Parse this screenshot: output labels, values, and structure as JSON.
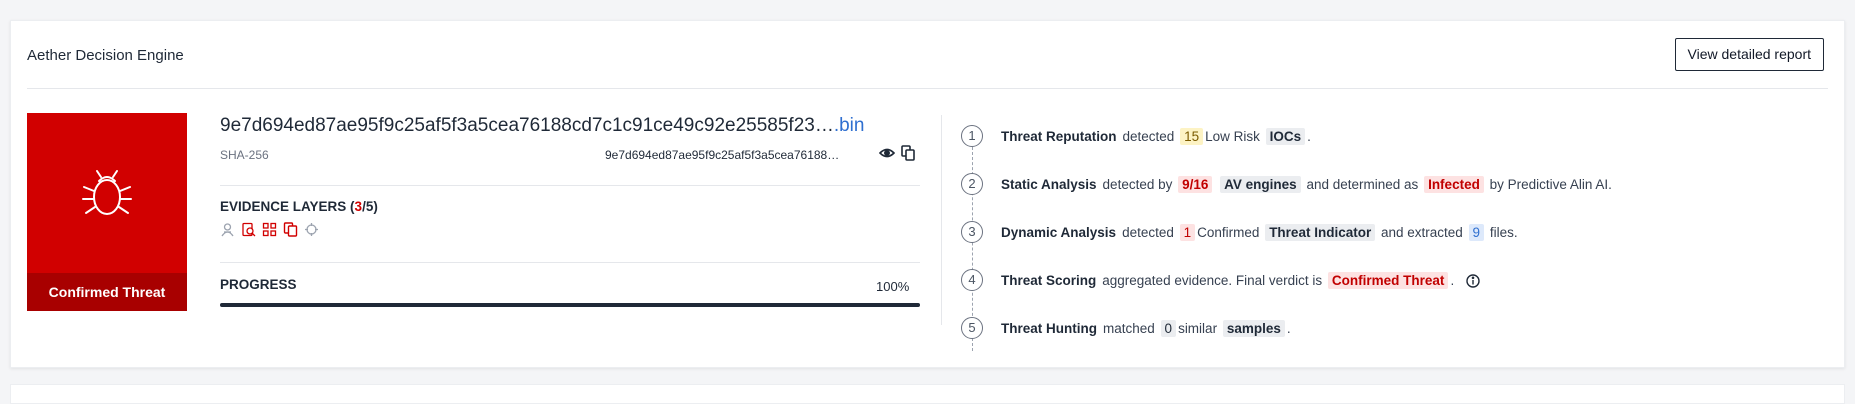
{
  "header": {
    "title": "Aether Decision Engine",
    "report_button": "View detailed report"
  },
  "verdict": {
    "label": "Confirmed Threat",
    "icon": "bug-icon",
    "color": "#d10000"
  },
  "file": {
    "hash_full": "9e7d694ed87ae95f9c25af5f3a5cea76188cd7c1c91ce49c92e25585f23…",
    "extension": ".bin",
    "hash_type": "SHA-256",
    "hash_short": "9e7d694ed87ae95f9c25af5f3a5cea76188…"
  },
  "evidence": {
    "title_prefix": "EVIDENCE LAYERS (",
    "count": "3",
    "title_suffix": "/5)",
    "icons": [
      "reputation-icon",
      "static-analysis-icon",
      "dynamic-analysis-icon",
      "copy-files-icon",
      "crosshair-icon"
    ]
  },
  "progress": {
    "label": "PROGRESS",
    "value_text": "100%",
    "value": 1.0
  },
  "steps": [
    {
      "num": "1",
      "name": "Threat Reputation",
      "t1": "detected",
      "chip1": "15",
      "t2": "Low Risk",
      "chip2": "IOCs",
      "t3": "."
    },
    {
      "num": "2",
      "name": "Static Analysis",
      "t1": "detected by",
      "chip1": "9/16",
      "chip2": "AV engines",
      "t2": "and determined as",
      "chip3": "Infected",
      "t3": "by Predictive Alin AI."
    },
    {
      "num": "3",
      "name": "Dynamic Analysis",
      "t1": "detected",
      "chip1": "1",
      "t2": "Confirmed",
      "chip2": "Threat Indicator",
      "t3": "and extracted",
      "chip3": "9",
      "t4": "files."
    },
    {
      "num": "4",
      "name": "Threat Scoring",
      "t1": "aggregated evidence. Final verdict is",
      "chip1": "Confirmed Threat",
      "t2": "."
    },
    {
      "num": "5",
      "name": "Threat Hunting",
      "t1": "matched",
      "chip1": "0",
      "t2": "similar",
      "chip2": "samples",
      "t3": "."
    }
  ]
}
